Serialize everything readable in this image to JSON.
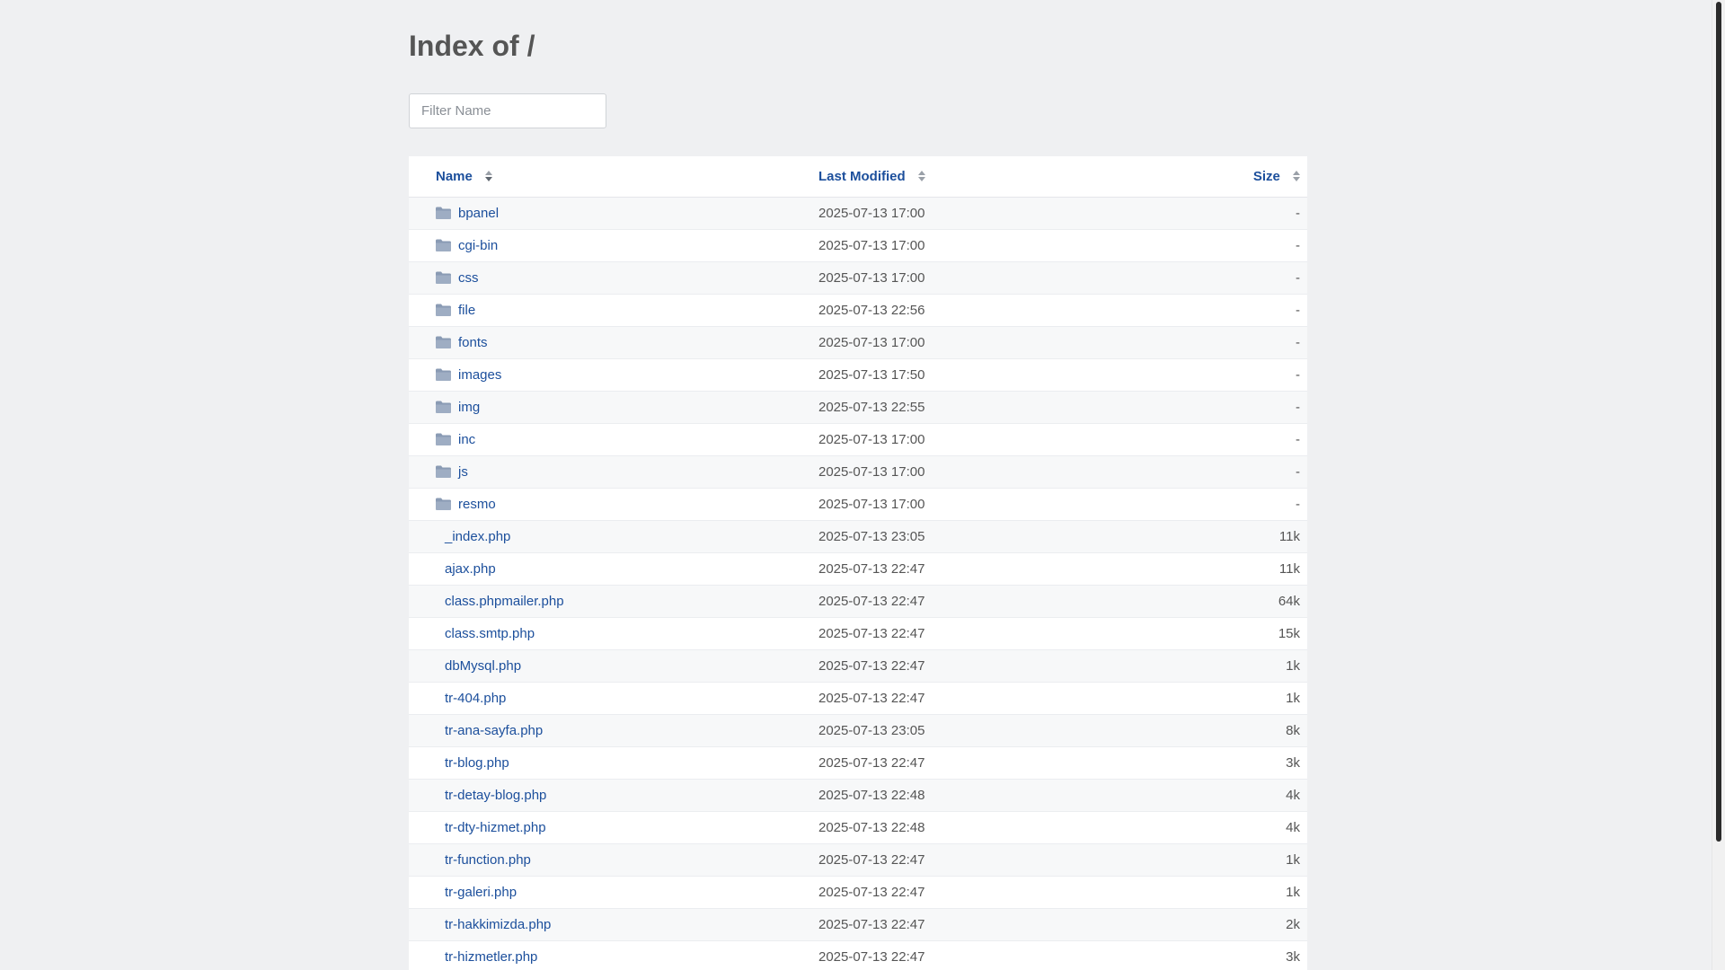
{
  "page": {
    "title": "Index of /",
    "filter_placeholder": "Filter Name"
  },
  "table": {
    "headers": {
      "name": "Name",
      "modified": "Last Modified",
      "size": "Size"
    },
    "rows": [
      {
        "name": "bpanel",
        "modified": "2025-07-13 17:00",
        "size": "-",
        "type": "folder"
      },
      {
        "name": "cgi-bin",
        "modified": "2025-07-13 17:00",
        "size": "-",
        "type": "folder"
      },
      {
        "name": "css",
        "modified": "2025-07-13 17:00",
        "size": "-",
        "type": "folder"
      },
      {
        "name": "file",
        "modified": "2025-07-13 22:56",
        "size": "-",
        "type": "folder"
      },
      {
        "name": "fonts",
        "modified": "2025-07-13 17:00",
        "size": "-",
        "type": "folder"
      },
      {
        "name": "images",
        "modified": "2025-07-13 17:50",
        "size": "-",
        "type": "folder"
      },
      {
        "name": "img",
        "modified": "2025-07-13 22:55",
        "size": "-",
        "type": "folder"
      },
      {
        "name": "inc",
        "modified": "2025-07-13 17:00",
        "size": "-",
        "type": "folder"
      },
      {
        "name": "js",
        "modified": "2025-07-13 17:00",
        "size": "-",
        "type": "folder"
      },
      {
        "name": "resmo",
        "modified": "2025-07-13 17:00",
        "size": "-",
        "type": "folder"
      },
      {
        "name": "_index.php",
        "modified": "2025-07-13 23:05",
        "size": "11k",
        "type": "file"
      },
      {
        "name": "ajax.php",
        "modified": "2025-07-13 22:47",
        "size": "11k",
        "type": "file"
      },
      {
        "name": "class.phpmailer.php",
        "modified": "2025-07-13 22:47",
        "size": "64k",
        "type": "file"
      },
      {
        "name": "class.smtp.php",
        "modified": "2025-07-13 22:47",
        "size": "15k",
        "type": "file"
      },
      {
        "name": "dbMysql.php",
        "modified": "2025-07-13 22:47",
        "size": "1k",
        "type": "file"
      },
      {
        "name": "tr-404.php",
        "modified": "2025-07-13 22:47",
        "size": "1k",
        "type": "file"
      },
      {
        "name": "tr-ana-sayfa.php",
        "modified": "2025-07-13 23:05",
        "size": "8k",
        "type": "file"
      },
      {
        "name": "tr-blog.php",
        "modified": "2025-07-13 22:47",
        "size": "3k",
        "type": "file"
      },
      {
        "name": "tr-detay-blog.php",
        "modified": "2025-07-13 22:48",
        "size": "4k",
        "type": "file"
      },
      {
        "name": "tr-dty-hizmet.php",
        "modified": "2025-07-13 22:48",
        "size": "4k",
        "type": "file"
      },
      {
        "name": "tr-function.php",
        "modified": "2025-07-13 22:47",
        "size": "1k",
        "type": "file"
      },
      {
        "name": "tr-galeri.php",
        "modified": "2025-07-13 22:47",
        "size": "1k",
        "type": "file"
      },
      {
        "name": "tr-hakkimizda.php",
        "modified": "2025-07-13 22:47",
        "size": "2k",
        "type": "file"
      },
      {
        "name": "tr-hizmetler.php",
        "modified": "2025-07-13 22:47",
        "size": "3k",
        "type": "file"
      }
    ]
  },
  "icons": {
    "folder": "folder-icon",
    "sort": "sort-arrows-icon"
  },
  "colors": {
    "link": "#1c4f9c",
    "folder": "#8a9bb4",
    "background": "#eff0f2"
  }
}
